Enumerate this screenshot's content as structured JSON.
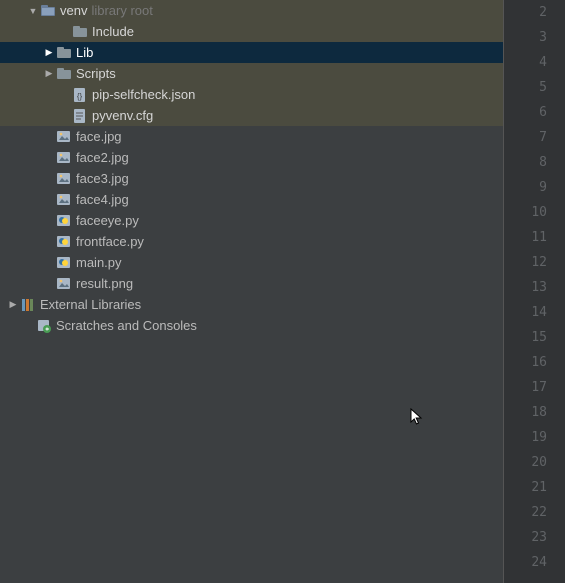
{
  "tree": [
    {
      "id": "venv",
      "indent": 28,
      "arrow": "down",
      "icon": "folder-root",
      "label": "venv",
      "suffix": "library root",
      "group": "venv"
    },
    {
      "id": "include",
      "indent": 60,
      "arrow": "",
      "icon": "folder",
      "label": "Include",
      "group": "venv"
    },
    {
      "id": "lib",
      "indent": 44,
      "arrow": "right",
      "icon": "folder",
      "label": "Lib",
      "group": "venv",
      "selected": true
    },
    {
      "id": "scripts",
      "indent": 44,
      "arrow": "right",
      "icon": "folder",
      "label": "Scripts",
      "group": "venv"
    },
    {
      "id": "pipselfcheck",
      "indent": 60,
      "arrow": "",
      "icon": "json",
      "label": "pip-selfcheck.json",
      "group": "venv"
    },
    {
      "id": "pyvenvcfg",
      "indent": 60,
      "arrow": "",
      "icon": "text",
      "label": "pyvenv.cfg",
      "group": "venv"
    },
    {
      "id": "facejpg",
      "indent": 44,
      "arrow": "",
      "icon": "image",
      "label": "face.jpg"
    },
    {
      "id": "face2jpg",
      "indent": 44,
      "arrow": "",
      "icon": "image",
      "label": "face2.jpg"
    },
    {
      "id": "face3jpg",
      "indent": 44,
      "arrow": "",
      "icon": "image",
      "label": "face3.jpg"
    },
    {
      "id": "face4jpg",
      "indent": 44,
      "arrow": "",
      "icon": "image",
      "label": "face4.jpg"
    },
    {
      "id": "faceeyepy",
      "indent": 44,
      "arrow": "",
      "icon": "python",
      "label": "faceeye.py"
    },
    {
      "id": "frontfacepy",
      "indent": 44,
      "arrow": "",
      "icon": "python",
      "label": "frontface.py"
    },
    {
      "id": "mainpy",
      "indent": 44,
      "arrow": "",
      "icon": "python",
      "label": "main.py"
    },
    {
      "id": "resultpng",
      "indent": 44,
      "arrow": "",
      "icon": "image",
      "label": "result.png"
    },
    {
      "id": "extlib",
      "indent": 8,
      "arrow": "right",
      "icon": "extlib",
      "label": "External Libraries"
    },
    {
      "id": "scratches",
      "indent": 24,
      "arrow": "",
      "icon": "scratches",
      "label": "Scratches and Consoles"
    }
  ],
  "gutter": {
    "start": 2,
    "end": 24
  }
}
